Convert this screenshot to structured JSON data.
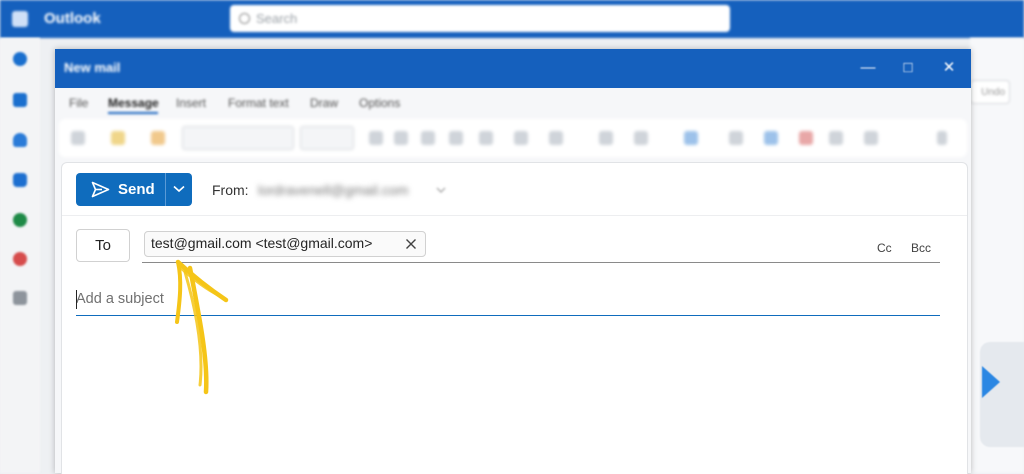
{
  "app": {
    "title": "Outlook",
    "search_placeholder": "Search",
    "brand_color": "#1560bd"
  },
  "compose_window": {
    "title": "New mail",
    "menu": [
      "File",
      "Message",
      "Insert",
      "Format text",
      "Draw",
      "Options"
    ],
    "active_menu": "Message"
  },
  "compose": {
    "send_label": "Send",
    "from_label": "From:",
    "from_value": "lordravenell@gmail.com",
    "to_label": "To",
    "recipient": "test@gmail.com <test@gmail.com>",
    "cc_label": "Cc",
    "bcc_label": "Bcc",
    "subject_placeholder": "Add a subject"
  },
  "background": {
    "filter_label": "Undo"
  },
  "icons": {
    "send": "send-icon",
    "dropdown": "chevron-down-icon",
    "remove": "close-icon",
    "minimize": "minimize-icon",
    "maximize": "maximize-icon",
    "close": "close-icon"
  },
  "annotation_color": "#f5c518"
}
